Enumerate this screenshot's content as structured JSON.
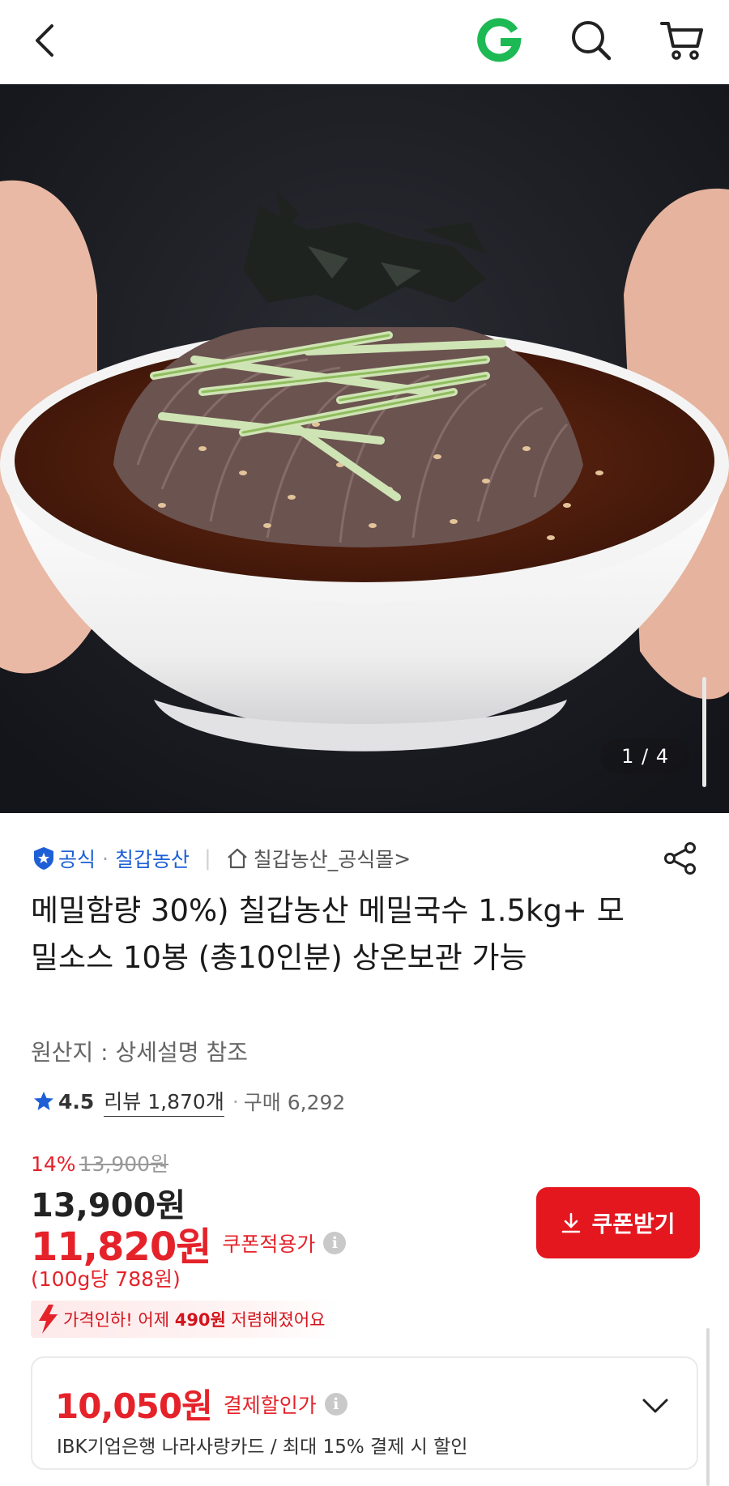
{
  "header": {
    "back_icon": "chevron-left-icon",
    "logo_letter": "G",
    "logo_color": "#1db954",
    "search_icon": "search-icon",
    "cart_icon": "cart-icon"
  },
  "gallery": {
    "counter": "1 / 4"
  },
  "seller": {
    "official_label": "공식",
    "official_color": "#1e5fd6",
    "separator_dot": "·",
    "seller_name": "칠갑농산",
    "divider": "|",
    "store_name": "칠갑농산_공식몰",
    "store_chevron": ">"
  },
  "product": {
    "title": "메밀함량 30%) 칠갑농산 메밀국수 1.5kg+ 모밀소스 10봉 (총10인분) 상온보관 가능",
    "origin": "원산지 : 상세설명 참조"
  },
  "rating": {
    "score": "4.5",
    "review": "리뷰 1,870개",
    "dot": "·",
    "purchase": "구매 6,292"
  },
  "price": {
    "discount_pct": "14%",
    "original": "13,900원",
    "current": "13,900원",
    "coupon_price": "11,820원",
    "coupon_label": "쿠폰적용가",
    "info": "i",
    "unit_price": "(100g당 788원)",
    "accent_color": "#e5222a"
  },
  "coupon_button": {
    "label": "쿠폰받기"
  },
  "price_drop": {
    "prefix": "가격인하! 어제 ",
    "amount": "490원",
    "suffix": " 저렴해졌어요"
  },
  "payment": {
    "amount": "10,050원",
    "label": "결제할인가",
    "info": "i",
    "description": "IBK기업은행 나라사랑카드 / 최대 15% 결제 시 할인"
  }
}
